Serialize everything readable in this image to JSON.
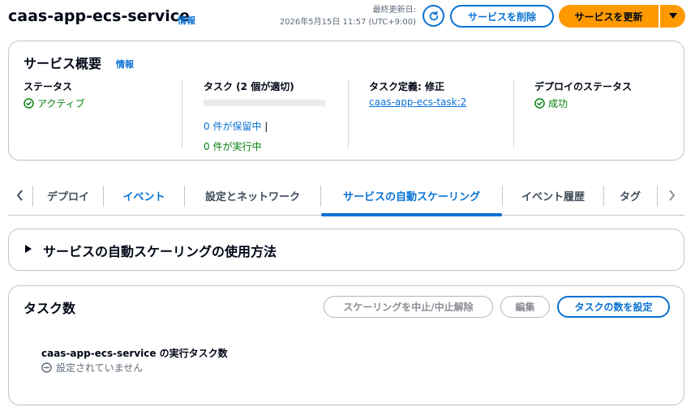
{
  "header": {
    "title": "caas-app-ecs-service",
    "info_label": "情報",
    "last_updated_label": "最終更新日:",
    "last_updated_value": "2026年5月15日 11:57 (UTC+9:00)",
    "delete_label": "サービスを削除",
    "update_label": "サービスを更新"
  },
  "overview": {
    "title": "サービス概要",
    "info_label": "情報",
    "status": {
      "label": "ステータス",
      "value": "アクティブ"
    },
    "tasks": {
      "label": "タスク (2 個が適切)",
      "pending": "0 件が保留中",
      "separator": "|",
      "running": "0 件が実行中"
    },
    "task_definition": {
      "label": "タスク定義: 修正",
      "value": "caas-app-ecs-task:2"
    },
    "deployment_status": {
      "label": "デプロイのステータス",
      "value": "成功"
    }
  },
  "tabs": {
    "items": [
      {
        "label": "デプロイ"
      },
      {
        "label": "イベント"
      },
      {
        "label": "設定とネットワーク"
      },
      {
        "label": "サービスの自動スケーリング"
      },
      {
        "label": "イベント履歴"
      },
      {
        "label": "タグ"
      }
    ],
    "active_index": 3
  },
  "expander": {
    "title": "サービスの自動スケーリングの使用方法"
  },
  "task_count": {
    "title": "タスク数",
    "suspend_label": "スケーリングを中止/中止解除",
    "edit_label": "編集",
    "set_label": "タスクの数を設定",
    "running_tasks_label": "caas-app-ecs-service の実行タスク数",
    "not_set": "設定されていません"
  },
  "colors": {
    "primary": "#ff9900",
    "link": "#0972d3",
    "success": "#037f0c",
    "muted": "#5f6b7a"
  },
  "icons": {
    "refresh": "refresh-icon",
    "caret": "caret-down-icon",
    "status_ok": "check-circle-icon",
    "not_set": "minus-circle-icon"
  }
}
